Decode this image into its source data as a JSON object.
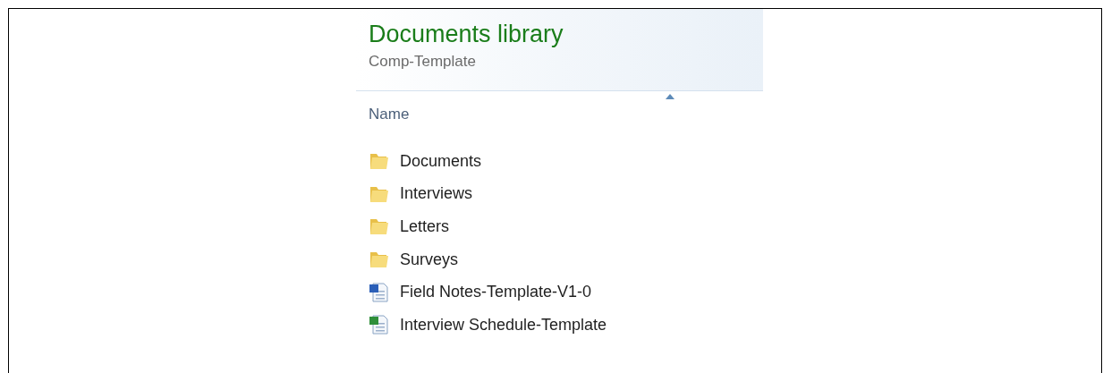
{
  "header": {
    "title": "Documents library",
    "subtitle": "Comp-Template"
  },
  "columns": [
    {
      "label": "Name",
      "sorted": true
    }
  ],
  "items": [
    {
      "kind": "folder",
      "name": "Documents"
    },
    {
      "kind": "folder",
      "name": "Interviews"
    },
    {
      "kind": "folder",
      "name": "Letters"
    },
    {
      "kind": "folder",
      "name": "Surveys"
    },
    {
      "kind": "word",
      "name": "Field Notes-Template-V1-0"
    },
    {
      "kind": "excel",
      "name": "Interview Schedule-Template"
    }
  ]
}
